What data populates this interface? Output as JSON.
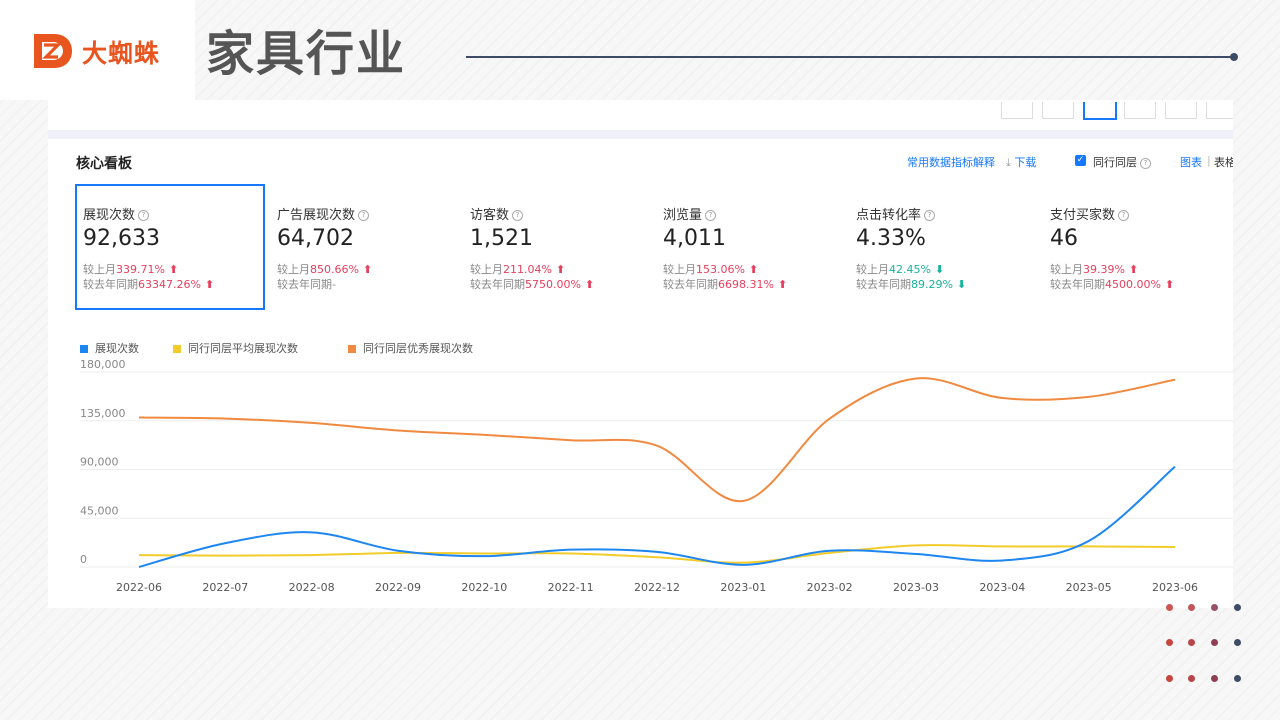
{
  "brand": {
    "name": "大蜘蛛",
    "color": "#e8551f"
  },
  "slide_title": "家具行业",
  "panel": {
    "section_title": "核心看板",
    "tools": {
      "common_metrics": "常用数据指标解释",
      "download": "下载",
      "peer": "同行同层",
      "chart": "图表",
      "divider": "|",
      "table": "表格"
    },
    "metrics": [
      {
        "label": "展现次数",
        "value": "92,633",
        "mom_label": "较上月",
        "mom": "339.71%",
        "mom_dir": "up",
        "yoy_label": "较去年同期",
        "yoy": "63347.26%",
        "yoy_dir": "up",
        "selected": true
      },
      {
        "label": "广告展现次数",
        "value": "64,702",
        "mom_label": "较上月",
        "mom": "850.66%",
        "mom_dir": "up",
        "yoy_label": "较去年同期",
        "yoy": "-",
        "yoy_dir": "none",
        "selected": false
      },
      {
        "label": "访客数",
        "value": "1,521",
        "mom_label": "较上月",
        "mom": "211.04%",
        "mom_dir": "up",
        "yoy_label": "较去年同期",
        "yoy": "5750.00%",
        "yoy_dir": "up",
        "selected": false
      },
      {
        "label": "浏览量",
        "value": "4,011",
        "mom_label": "较上月",
        "mom": "153.06%",
        "mom_dir": "up",
        "yoy_label": "较去年同期",
        "yoy": "6698.31%",
        "yoy_dir": "up",
        "selected": false
      },
      {
        "label": "点击转化率",
        "value": "4.33%",
        "mom_label": "较上月",
        "mom": "42.45%",
        "mom_dir": "down",
        "yoy_label": "较去年同期",
        "yoy": "89.29%",
        "yoy_dir": "down",
        "selected": false
      },
      {
        "label": "支付买家数",
        "value": "46",
        "mom_label": "较上月",
        "mom": "39.39%",
        "mom_dir": "up",
        "yoy_label": "较去年同期",
        "yoy": "4500.00%",
        "yoy_dir": "up",
        "selected": false
      }
    ],
    "colors": {
      "accent": "#1677ff",
      "up": "#e5405e",
      "down": "#17b39b"
    }
  },
  "chart_data": {
    "type": "line",
    "x": [
      "2022-06",
      "2022-07",
      "2022-08",
      "2022-09",
      "2022-10",
      "2022-11",
      "2022-12",
      "2023-01",
      "2023-02",
      "2023-03",
      "2023-04",
      "2023-05",
      "2023-06"
    ],
    "yticks": [
      "180,000",
      "135,000",
      "90,000",
      "45,000",
      "0"
    ],
    "ylim": [
      0,
      180000
    ],
    "grid": true,
    "legend_position": "top-left",
    "series": [
      {
        "name": "展现次数",
        "color": "#1e86f0",
        "values": [
          0,
          22000,
          32000,
          15000,
          10000,
          16000,
          14000,
          2000,
          15000,
          12000,
          6000,
          24000,
          92633
        ]
      },
      {
        "name": "同行同层平均展现次数",
        "color": "#f2cc2a",
        "values": [
          11000,
          10500,
          11000,
          13000,
          12500,
          12500,
          9000,
          4000,
          13000,
          20000,
          19000,
          19000,
          18500
        ]
      },
      {
        "name": "同行同层优秀展现次数",
        "color": "#f08a40",
        "values": [
          138000,
          137000,
          133000,
          126000,
          122000,
          117000,
          112000,
          61000,
          137000,
          174000,
          156000,
          157000,
          173000
        ]
      }
    ]
  }
}
